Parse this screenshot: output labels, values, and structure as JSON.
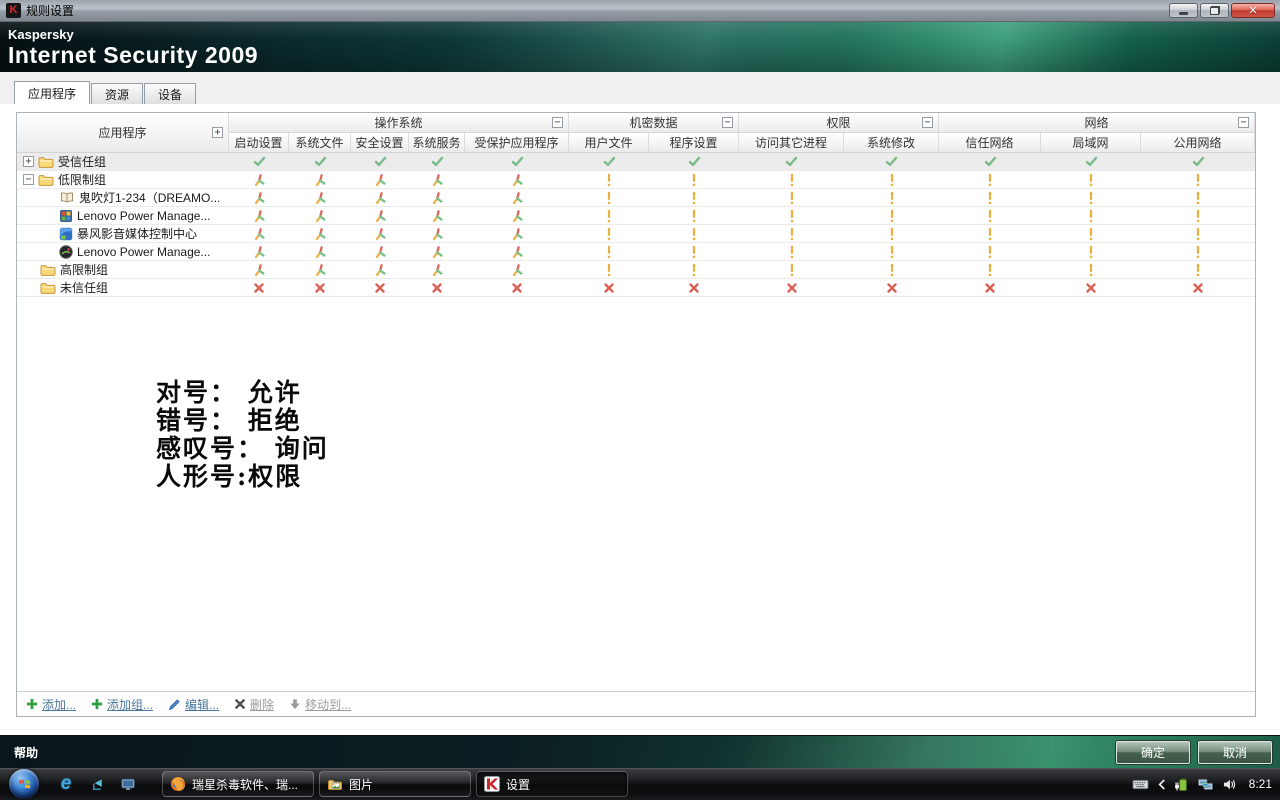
{
  "window": {
    "title": "规则设置"
  },
  "icons": {
    "k": "K",
    "ie": "e"
  },
  "brand": {
    "company": "Kaspersky",
    "product": "Internet Security 2009"
  },
  "tabs": [
    {
      "label": "应用程序",
      "active": true
    },
    {
      "label": "资源",
      "active": false
    },
    {
      "label": "设备",
      "active": false
    }
  ],
  "table": {
    "app_header": "应用程序",
    "groups": [
      {
        "label": "操作系统",
        "columns": [
          "启动设置",
          "系统文件",
          "安全设置",
          "系统服务",
          "受保护应用程序"
        ]
      },
      {
        "label": "机密数据",
        "columns": [
          "用户文件",
          "程序设置"
        ]
      },
      {
        "label": "权限",
        "columns": [
          "访问其它进程",
          "系统修改"
        ]
      },
      {
        "label": "网络",
        "columns": [
          "信任网络",
          "局域网",
          "公用网络"
        ]
      }
    ],
    "rows": [
      {
        "label": "受信任组",
        "level": 0,
        "expander": "plus",
        "icon": "folder",
        "shaded": true,
        "cells": [
          "check",
          "check",
          "check",
          "check",
          "check",
          "check",
          "check",
          "check",
          "check",
          "check",
          "check",
          "check"
        ]
      },
      {
        "label": "低限制组",
        "level": 0,
        "expander": "minus",
        "icon": "folder",
        "shaded": false,
        "cells": [
          "person",
          "person",
          "person",
          "person",
          "person",
          "ask",
          "ask",
          "ask",
          "ask",
          "ask",
          "ask",
          "ask"
        ]
      },
      {
        "label": "鬼吹灯1-234（DREAMO...",
        "level": 1,
        "expander": null,
        "icon": "book",
        "shaded": false,
        "cells": [
          "person",
          "person",
          "person",
          "person",
          "person",
          "ask",
          "ask",
          "ask",
          "ask",
          "ask",
          "ask",
          "ask"
        ]
      },
      {
        "label": "Lenovo Power Manage...",
        "level": 1,
        "expander": null,
        "icon": "lenovo",
        "shaded": false,
        "cells": [
          "person",
          "person",
          "person",
          "person",
          "person",
          "ask",
          "ask",
          "ask",
          "ask",
          "ask",
          "ask",
          "ask"
        ]
      },
      {
        "label": "暴风影音媒体控制中心",
        "level": 1,
        "expander": null,
        "icon": "media",
        "shaded": false,
        "cells": [
          "person",
          "person",
          "person",
          "person",
          "person",
          "ask",
          "ask",
          "ask",
          "ask",
          "ask",
          "ask",
          "ask"
        ]
      },
      {
        "label": "Lenovo Power Manage...",
        "level": 1,
        "expander": null,
        "icon": "lenovo2",
        "shaded": false,
        "cells": [
          "person",
          "person",
          "person",
          "person",
          "person",
          "ask",
          "ask",
          "ask",
          "ask",
          "ask",
          "ask",
          "ask"
        ]
      },
      {
        "label": "高限制组",
        "level": 0,
        "expander": null,
        "icon": "folder",
        "shaded": false,
        "cells": [
          "person",
          "person",
          "person",
          "person",
          "person",
          "ask",
          "ask",
          "ask",
          "ask",
          "ask",
          "ask",
          "ask"
        ]
      },
      {
        "label": "未信任组",
        "level": 0,
        "expander": null,
        "icon": "folder",
        "shaded": false,
        "cells": [
          "cross",
          "cross",
          "cross",
          "cross",
          "cross",
          "cross",
          "cross",
          "cross",
          "cross",
          "cross",
          "cross",
          "cross"
        ]
      }
    ]
  },
  "legend": {
    "lines": [
      "对号： 允许",
      "错号： 拒绝",
      "感叹号： 询问",
      "人形号:权限"
    ]
  },
  "toolbar": {
    "items": [
      {
        "name": "add",
        "label": "添加...",
        "icon": "plus",
        "enabled": true
      },
      {
        "name": "add-group",
        "label": "添加组...",
        "icon": "plus",
        "enabled": true
      },
      {
        "name": "edit",
        "label": "编辑...",
        "icon": "pencil",
        "enabled": true
      },
      {
        "name": "delete",
        "label": "删除",
        "icon": "delx",
        "enabled": false
      },
      {
        "name": "move-to",
        "label": "移动到...",
        "icon": "movedown",
        "enabled": false
      }
    ]
  },
  "footer": {
    "help": "帮助",
    "ok": "确定",
    "cancel": "取消"
  },
  "taskbar": {
    "tasks": [
      {
        "name": "rising-antivirus",
        "label": "瑞星杀毒软件、瑞...",
        "icon": "firefox",
        "active": false
      },
      {
        "name": "pictures",
        "label": "图片",
        "icon": "pictures",
        "active": false
      },
      {
        "name": "settings",
        "label": "设置",
        "icon": "kaspersky",
        "active": true
      }
    ],
    "clock": "8:21"
  },
  "colors": {
    "allow": "#7dbb8c",
    "ask": "#eab041",
    "deny": "#dd5f55",
    "person_red": "#e0685c",
    "person_orange": "#edb44e",
    "person_green": "#7cbf8e",
    "link": "#4a769c",
    "banner_green": "#2e8a6c"
  }
}
